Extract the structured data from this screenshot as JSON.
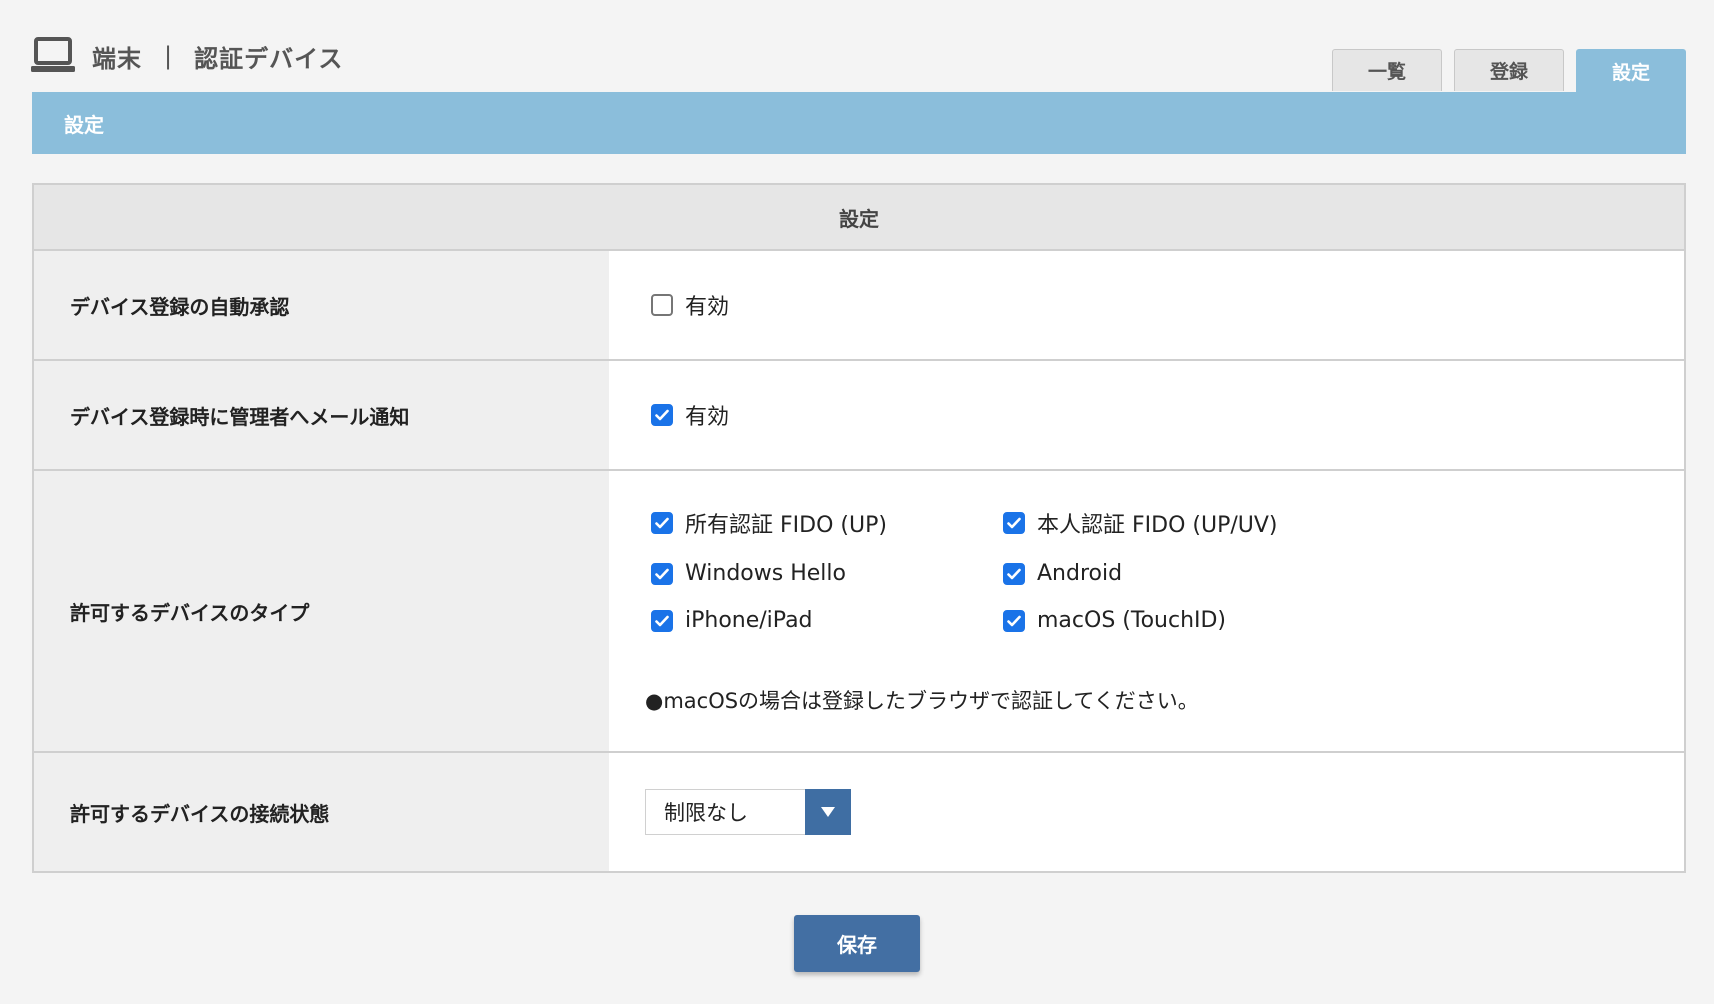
{
  "header": {
    "icon": "laptop-icon",
    "section": "端末",
    "separator": "|",
    "title": "認証デバイス"
  },
  "tabs": [
    {
      "label": "一覧",
      "active": false
    },
    {
      "label": "登録",
      "active": false
    },
    {
      "label": "設定",
      "active": true
    }
  ],
  "panel_title": "設定",
  "table": {
    "header": "設定",
    "rows": {
      "auto_approve": {
        "label": "デバイス登録の自動承認",
        "option_label": "有効",
        "checked": false
      },
      "admin_notify": {
        "label": "デバイス登録時に管理者へメール通知",
        "option_label": "有効",
        "checked": true
      },
      "device_types": {
        "label": "許可するデバイスのタイプ",
        "options": [
          {
            "label": "所有認証 FIDO (UP)",
            "checked": true
          },
          {
            "label": "本人認証 FIDO (UP/UV)",
            "checked": true
          },
          {
            "label": "Windows Hello",
            "checked": true
          },
          {
            "label": "Android",
            "checked": true
          },
          {
            "label": "iPhone/iPad",
            "checked": true
          },
          {
            "label": "macOS (TouchID)",
            "checked": true
          }
        ],
        "note": "●macOSの場合は登録したブラウザで認証してください。"
      },
      "connection_state": {
        "label": "許可するデバイスの接続状態",
        "selected": "制限なし"
      }
    }
  },
  "save_label": "保存",
  "colors": {
    "accent": "#8bbedb",
    "checkbox": "#1a73e8",
    "button": "#436fa3"
  }
}
